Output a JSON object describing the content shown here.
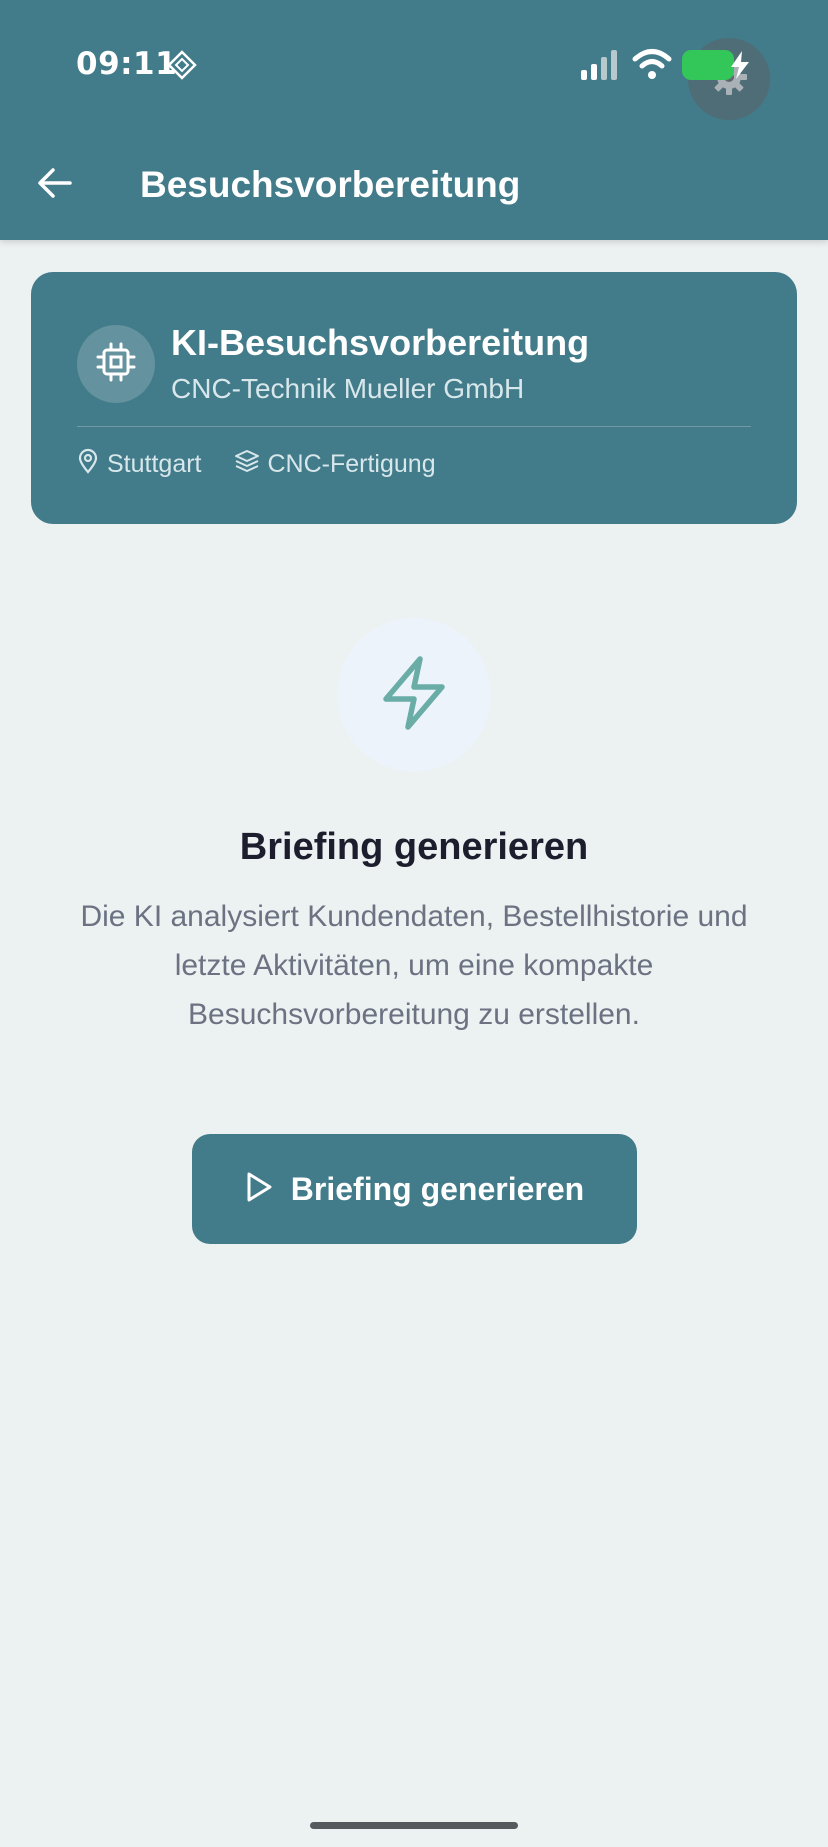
{
  "status_bar": {
    "time": "09:11",
    "battery_color": "#33c759"
  },
  "header": {
    "title": "Besuchsvorbereitung",
    "background": "#427b89",
    "back_icon": "arrow-left-icon",
    "settings_icon": "gear-icon"
  },
  "card": {
    "icon": "cpu-chip-icon",
    "title": "KI-Besuchsvorbereitung",
    "subtitle": "CNC-Technik Mueller GmbH",
    "location_icon": "map-pin-icon",
    "location": "Stuttgart",
    "industry_icon": "layers-icon",
    "industry": "CNC-Fertigung"
  },
  "empty_state": {
    "icon": "lightning-bolt-icon",
    "icon_color": "#6aada7",
    "title": "Briefing generieren",
    "description": "Die KI analysiert Kundendaten, Bestellhistorie und letzte Aktivitäten, um eine kompakte Besuchsvorbereitung zu erstellen.",
    "button_icon": "play-icon",
    "button_label": "Briefing generieren"
  }
}
